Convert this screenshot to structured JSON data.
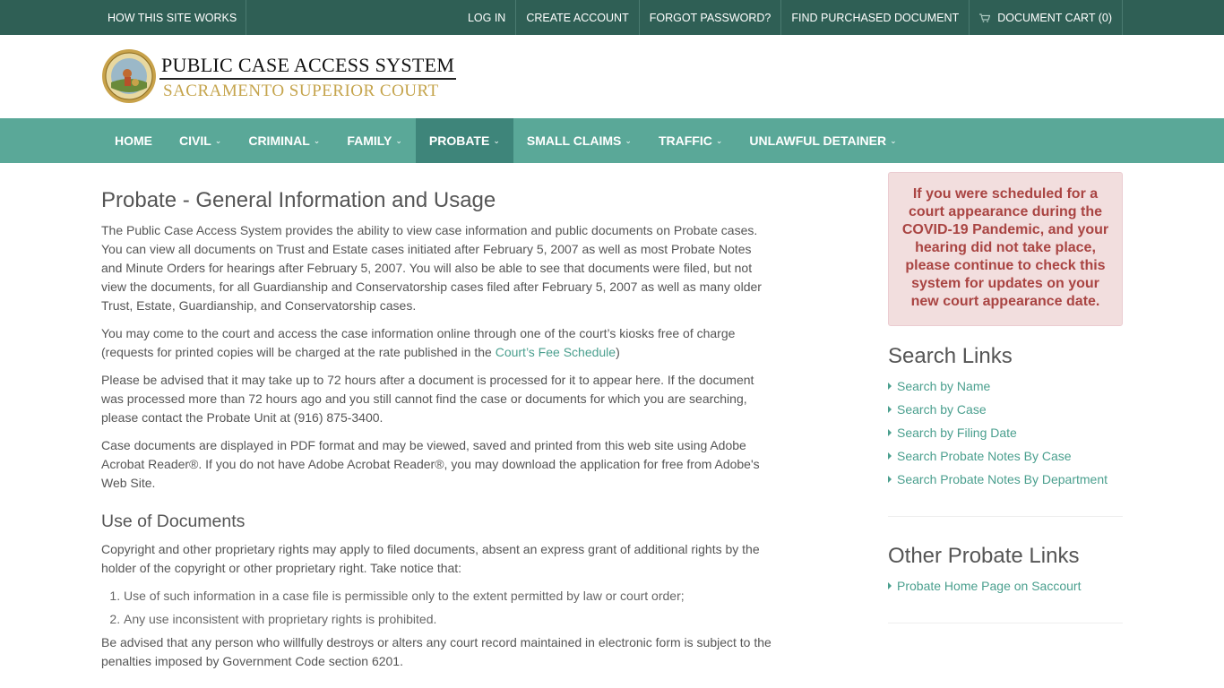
{
  "topbar": {
    "how_it_works": "HOW THIS SITE WORKS",
    "log_in": "LOG IN",
    "create_account": "CREATE ACCOUNT",
    "forgot_password": "FORGOT PASSWORD?",
    "find_purchased": "FIND PURCHASED DOCUMENT",
    "document_cart": "DOCUMENT CART (0)"
  },
  "header": {
    "title": "PUBLIC CASE ACCESS SYSTEM",
    "subtitle": "SACRAMENTO SUPERIOR COURT"
  },
  "nav": {
    "items": [
      {
        "label": "HOME"
      },
      {
        "label": "CIVIL"
      },
      {
        "label": "CRIMINAL"
      },
      {
        "label": "FAMILY"
      },
      {
        "label": "PROBATE"
      },
      {
        "label": "SMALL CLAIMS"
      },
      {
        "label": "TRAFFIC"
      },
      {
        "label": "UNLAWFUL DETAINER"
      }
    ],
    "active": "PROBATE"
  },
  "main": {
    "title": "Probate - General Information and Usage",
    "p1": "The Public Case Access System provides the ability to view case information and public documents on Probate cases. You can view all documents on Trust and Estate cases initiated after February 5, 2007 as well as most Probate Notes and Minute Orders for hearings after February 5, 2007. You will also be able to see that documents were filed, but not view the documents, for all Guardianship and Conservatorship cases filed after February 5, 2007 as well as many older Trust, Estate, Guardianship, and Conservatorship cases.",
    "p2_pre": "You may come to the court and access the case information online through one of the court’s kiosks free of charge (requests for printed copies will be charged at the rate published in the ",
    "p2_link": "Court’s Fee Schedule",
    "p2_post": ")",
    "p3": "Please be advised that it may take up to 72 hours after a document is processed for it to appear here. If the document was processed more than 72 hours ago and you still cannot find the case or documents for which you are searching, please contact the Probate Unit at (916) 875-3400.",
    "p4": "Case documents are displayed in PDF format and may be viewed, saved and printed from this web site using Adobe Acrobat Reader®. If you do not have Adobe Acrobat Reader®, you may download the application for free from Adobe's Web Site.",
    "use_title": "Use of Documents",
    "p5": "Copyright and other proprietary rights may apply to filed documents, absent an express grant of additional rights by the holder of the copyright or other proprietary right. Take notice that:",
    "list": [
      "Use of such information in a case file is permissible only to the extent permitted by law or court order;",
      "Any use inconsistent with proprietary rights is prohibited."
    ],
    "p6": "Be advised that any person who willfully destroys or alters any court record maintained in electronic form is subject to the penalties imposed by Government Code section 6201."
  },
  "sidebar": {
    "alert": "If you were scheduled for a court appearance during the COVID-19 Pandemic, and your hearing did not take place, please continue to check this system for updates on your new court appearance date.",
    "search_title": "Search Links",
    "search_links": [
      "Search by Name",
      "Search by Case",
      "Search by Filing Date",
      "Search Probate Notes By Case",
      "Search Probate Notes By Department"
    ],
    "other_title": "Other Probate Links",
    "other_links": [
      "Probate Home Page on Saccourt"
    ]
  },
  "colors": {
    "topbar": "#2f5f55",
    "nav": "#5aa898",
    "nav_active": "#3e857a",
    "link": "#4a9f8e",
    "gold": "#c5a44c",
    "alert_bg": "#f2dede",
    "alert_text": "#a94442"
  }
}
